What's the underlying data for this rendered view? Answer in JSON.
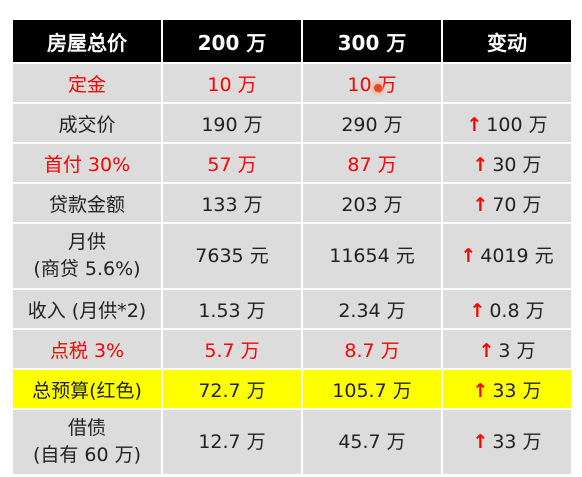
{
  "headers": [
    "房屋总价",
    "200 万",
    "300 万",
    "变动"
  ],
  "arrow_glyph": "↑",
  "colors": {
    "header_bg": "#000000",
    "cell_bg": "#dcdcdc",
    "highlight": "#ffff00",
    "accent_red": "#ff0000"
  },
  "rows": [
    {
      "label": "定金",
      "c200": "10 万",
      "c300": "10 万",
      "change": ""
    },
    {
      "label": "成交价",
      "c200": "190 万",
      "c300": "290 万",
      "change": "100 万"
    },
    {
      "label": "首付 30%",
      "c200": "57 万",
      "c300": "87 万",
      "change": "30 万"
    },
    {
      "label": "贷款金额",
      "c200": "133 万",
      "c300": "203 万",
      "change": "70 万"
    },
    {
      "label_line1": "月供",
      "label_line2": "(商贷 5.6%)",
      "c200": "7635 元",
      "c300": "11654 元",
      "change": "4019 元"
    },
    {
      "label": "收入 (月供*2)",
      "c200": "1.53 万",
      "c300": "2.34 万",
      "change": "0.8 万"
    },
    {
      "label": "点税 3%",
      "c200": "5.7 万",
      "c300": "8.7 万",
      "change": "3 万"
    },
    {
      "label": "总预算(红色)",
      "c200": "72.7 万",
      "c300": "105.7 万",
      "change": "33 万"
    },
    {
      "label_line1": "借债",
      "label_line2": "(自有 60 万)",
      "c200": "12.7 万",
      "c300": "45.7 万",
      "change": "33 万"
    }
  ]
}
